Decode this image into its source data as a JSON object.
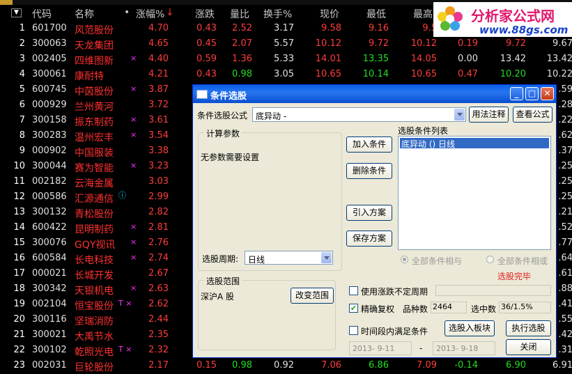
{
  "columns": [
    "代码",
    "名称",
    "•",
    "涨幅%",
    "涨跌",
    "量比",
    "换手%",
    "现价",
    "最低",
    "最高"
  ],
  "rows": [
    {
      "no": "1",
      "code": "601700",
      "name": "风范股份",
      "mark": "",
      "pct": "4.70",
      "chg": "0.43",
      "vol": "2.52",
      "turn": "3.17",
      "price": "9.58",
      "low": "9.16",
      "high": "9.5",
      "x1": "",
      "x2": "",
      "x3": ""
    },
    {
      "no": "2",
      "code": "300063",
      "name": "天龙集团",
      "mark": "",
      "pct": "4.65",
      "chg": "0.45",
      "vol": "2.07",
      "turn": "5.57",
      "price": "10.12",
      "low": "9.72",
      "high": "10.12",
      "x1": "0.19",
      "x2": "9.72",
      "x3": "9.67"
    },
    {
      "no": "3",
      "code": "002405",
      "name": "四维图新",
      "mark": "×",
      "pct": "4.40",
      "chg": "0.59",
      "vol": "1.36",
      "turn": "5.33",
      "price": "14.01",
      "low": "13.35",
      "high": "14.05",
      "x1": "0.00",
      "x2": "13.42",
      "x3": "13.42"
    },
    {
      "no": "4",
      "code": "300061",
      "name": "康耐特",
      "mark": "",
      "pct": "4.21",
      "chg": "0.43",
      "vol": "0.98",
      "turn": "3.05",
      "price": "10.65",
      "low": "10.14",
      "high": "10.65",
      "x1": "0.47",
      "x2": "10.20",
      "x3": "10.22"
    },
    {
      "no": "5",
      "code": "600745",
      "name": "中茵股份",
      "mark": "×",
      "pct": "3.87",
      "x3": ".59"
    },
    {
      "no": "6",
      "code": "000929",
      "name": "兰州黄河",
      "mark": "",
      "pct": "3.72",
      "x3": ".28"
    },
    {
      "no": "7",
      "code": "300158",
      "name": "振东制药",
      "mark": "×",
      "pct": "3.61",
      "x3": ".22"
    },
    {
      "no": "8",
      "code": "300283",
      "name": "温州宏丰",
      "mark": "×",
      "pct": "3.54",
      "x3": ".62"
    },
    {
      "no": "9",
      "code": "000902",
      "name": "中国服装",
      "mark": "",
      "pct": "3.38",
      "x3": ".37"
    },
    {
      "no": "10",
      "code": "300044",
      "name": "赛为智能",
      "mark": "×",
      "pct": "3.23",
      "x3": ".25"
    },
    {
      "no": "11",
      "code": "002182",
      "name": "云海金属",
      "mark": "",
      "pct": "3.03",
      "x3": ".25"
    },
    {
      "no": "12",
      "code": "000586",
      "name": "汇源通信",
      "mark": "ⓘ",
      "pct": "2.99",
      "x3": ".25"
    },
    {
      "no": "13",
      "code": "300132",
      "name": "青松股份",
      "mark": "",
      "pct": "2.82",
      "x3": ".21"
    },
    {
      "no": "14",
      "code": "600422",
      "name": "昆明制药",
      "mark": "×",
      "pct": "2.81",
      "x3": ".52"
    },
    {
      "no": "15",
      "code": "300076",
      "name": "GQY视讯",
      "mark": "×",
      "pct": "2.76",
      "x3": ".77"
    },
    {
      "no": "16",
      "code": "600584",
      "name": "长电科技",
      "mark": "×",
      "pct": "2.74",
      "x3": ".64"
    },
    {
      "no": "17",
      "code": "000021",
      "name": "长城开发",
      "mark": "",
      "pct": "2.67",
      "x3": ".61"
    },
    {
      "no": "18",
      "code": "300342",
      "name": "天银机电",
      "mark": "×",
      "pct": "2.63",
      "x3": ".88"
    },
    {
      "no": "19",
      "code": "002104",
      "name": "恒宝股份",
      "mark": "T ×",
      "pct": "2.62",
      "x3": ".41"
    },
    {
      "no": "20",
      "code": "300116",
      "name": "坚瑞消防",
      "mark": "",
      "pct": "2.44",
      "x3": ".55"
    },
    {
      "no": "21",
      "code": "300021",
      "name": "大禹节水",
      "mark": "",
      "pct": "2.35",
      "x3": ".42"
    },
    {
      "no": "22",
      "code": "300102",
      "name": "乾照光电",
      "mark": "T ×",
      "pct": "2.32",
      "x3": ".31"
    },
    {
      "no": "23",
      "code": "002031",
      "name": "巨轮股份",
      "mark": "",
      "pct": "2.17",
      "chg": "0.15",
      "vol": "0.98",
      "turn": "0.92",
      "price": "7.06",
      "low": "6.86",
      "high": "7.09",
      "x1": "-0.14",
      "x2": "6.90",
      "x3": "6.91"
    }
  ],
  "watermark": {
    "line1": "分析家公式网",
    "line2": "www.88gs.com"
  },
  "dialog": {
    "title": "条件选股",
    "formula_label": "条件选股公式",
    "formula_value": "底异动   -",
    "usage_btn": "用法注释",
    "view_btn": "查看公式",
    "params_group": "计算参数",
    "params_text": "无参数需要设置",
    "period_label": "选股周期:",
    "period_value": "日线",
    "add_btn": "加入条件",
    "del_btn": "删除条件",
    "import_btn": "引入方案",
    "save_btn": "保存方案",
    "list_title": "选股条件列表",
    "list_items": [
      "底异动  () 日线"
    ],
    "radio_and": "全部条件相与",
    "radio_or": "全部条件相或",
    "status": "选股完毕",
    "range_group": "选股范围",
    "range_value": "深沪A 股",
    "change_range_btn": "改变范围",
    "chk_indeterminate": "使用涨跌不定周期",
    "chk_exact": "精确复权",
    "count_label": "品种数",
    "count_value": "2464",
    "hit_label": "选中数",
    "hit_value": "36/1.5%",
    "chk_interval": "时间段内满足条件",
    "to_block_btn": "选股入板块",
    "run_btn": "执行选股",
    "date_from": "2013- 9-11",
    "date_sep": "-",
    "date_to": "2013- 9-18",
    "close_btn": "关闭"
  },
  "colors": {
    "up": "#ff3c3c",
    "down": "#22dd22",
    "dialog_bg": "#ece9d8",
    "title_bar": "#0a5fe8"
  }
}
